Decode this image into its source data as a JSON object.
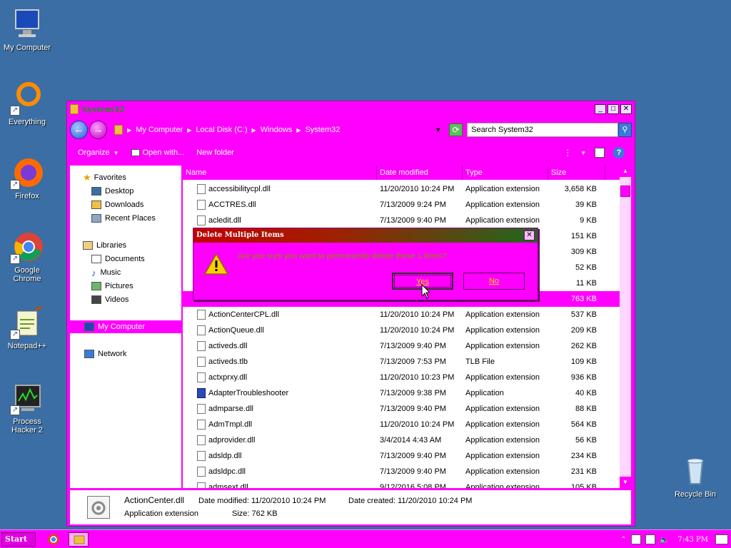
{
  "desktop": {
    "icons": [
      {
        "label": "My Computer",
        "icon": "computer-icon"
      },
      {
        "label": "Everything",
        "icon": "everything-icon"
      },
      {
        "label": "Firefox",
        "icon": "firefox-icon"
      },
      {
        "label": "Google Chrome",
        "icon": "chrome-icon"
      },
      {
        "label": "Notepad++",
        "icon": "notepadpp-icon"
      },
      {
        "label": "Process Hacker 2",
        "icon": "process-hacker-icon"
      },
      {
        "label": "Recycle Bin",
        "icon": "recycle-bin-icon"
      }
    ]
  },
  "window": {
    "title": "System32",
    "address": {
      "crumbs": [
        "My Computer",
        "Local Disk (C:)",
        "Windows",
        "System32"
      ]
    },
    "search_placeholder": "Search System32",
    "commands": {
      "organize": "Organize",
      "open_with": "Open with...",
      "new_folder": "New folder"
    },
    "nav": {
      "favorites": "Favorites",
      "desktop": "Desktop",
      "downloads": "Downloads",
      "recent_places": "Recent Places",
      "libraries": "Libraries",
      "documents": "Documents",
      "music": "Music",
      "pictures": "Pictures",
      "videos": "Videos",
      "my_computer": "My Computer",
      "network": "Network"
    },
    "columns": {
      "name": "Name",
      "date": "Date modified",
      "type": "Type",
      "size": "Size"
    },
    "files": [
      {
        "name": "accessibilitycpl.dll",
        "date": "11/20/2010 10:24 PM",
        "type": "Application extension",
        "size": "3,658 KB"
      },
      {
        "name": "ACCTRES.dll",
        "date": "7/13/2009 9:24 PM",
        "type": "Application extension",
        "size": "39 KB"
      },
      {
        "name": "acledit.dll",
        "date": "7/13/2009 9:40 PM",
        "type": "Application extension",
        "size": "9 KB"
      },
      {
        "name": "",
        "date": "",
        "type": "",
        "size": "151 KB"
      },
      {
        "name": "",
        "date": "",
        "type": "",
        "size": "309 KB"
      },
      {
        "name": "",
        "date": "",
        "type": "",
        "size": "52 KB"
      },
      {
        "name": "",
        "date": "",
        "type": "",
        "size": "11 KB"
      },
      {
        "name": "",
        "date": "",
        "type": "",
        "size": "763 KB"
      },
      {
        "name": "ActionCenterCPL.dll",
        "date": "11/20/2010 10:24 PM",
        "type": "Application extension",
        "size": "537 KB"
      },
      {
        "name": "ActionQueue.dll",
        "date": "11/20/2010 10:24 PM",
        "type": "Application extension",
        "size": "209 KB"
      },
      {
        "name": "activeds.dll",
        "date": "7/13/2009 9:40 PM",
        "type": "Application extension",
        "size": "262 KB"
      },
      {
        "name": "activeds.tlb",
        "date": "7/13/2009 7:53 PM",
        "type": "TLB File",
        "size": "109 KB"
      },
      {
        "name": "actxprxy.dll",
        "date": "11/20/2010 10:23 PM",
        "type": "Application extension",
        "size": "936 KB"
      },
      {
        "name": "AdapterTroubleshooter",
        "date": "7/13/2009 9:38 PM",
        "type": "Application",
        "size": "40 KB"
      },
      {
        "name": "admparse.dll",
        "date": "7/13/2009 9:40 PM",
        "type": "Application extension",
        "size": "88 KB"
      },
      {
        "name": "AdmTmpl.dll",
        "date": "11/20/2010 10:24 PM",
        "type": "Application extension",
        "size": "564 KB"
      },
      {
        "name": "adprovider.dll",
        "date": "3/4/2014 4:43 AM",
        "type": "Application extension",
        "size": "56 KB"
      },
      {
        "name": "adsldp.dll",
        "date": "7/13/2009 9:40 PM",
        "type": "Application extension",
        "size": "234 KB"
      },
      {
        "name": "adsldpc.dll",
        "date": "7/13/2009 9:40 PM",
        "type": "Application extension",
        "size": "231 KB"
      },
      {
        "name": "admsext.dll",
        "date": "9/12/2016 5:08 PM",
        "type": "Application extension",
        "size": "105 KB"
      }
    ],
    "details": {
      "name": "ActionCenter.dll",
      "type": "Application extension",
      "modified": "Date modified: 11/20/2010 10:24 PM",
      "created": "Date created: 11/20/2010 10:24 PM",
      "size": "Size: 762 KB"
    }
  },
  "dialog": {
    "title": "Delete Multiple Items",
    "message": "Are you sure you want to permanently delete these 1 items?",
    "yes": "Yes",
    "no": "No"
  },
  "taskbar": {
    "start": "Start",
    "clock": "7:43 PM"
  },
  "colors": {
    "accent": "#ff00ff",
    "desktop": "#3a6ea5"
  }
}
